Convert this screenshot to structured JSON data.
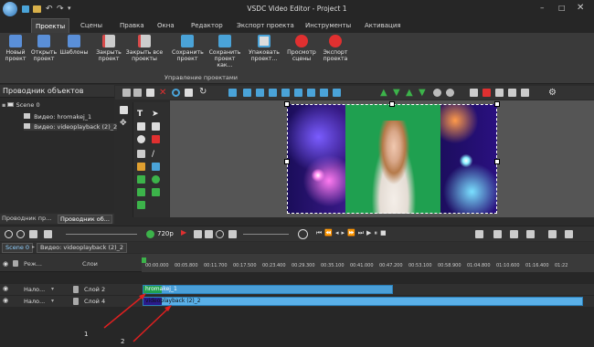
{
  "window": {
    "title": "VSDC Video Editor - Project 1"
  },
  "tabs": [
    {
      "label": "Проекты"
    },
    {
      "label": "Сцены"
    },
    {
      "label": "Правка"
    },
    {
      "label": "Окна"
    },
    {
      "label": "Редактор"
    },
    {
      "label": "Экспорт проекта"
    },
    {
      "label": "Инструменты"
    },
    {
      "label": "Активация"
    }
  ],
  "ribbon": {
    "buttons": [
      {
        "label": "Новый проект",
        "icon": "new-project-icon",
        "color": "#5a8fd8"
      },
      {
        "label": "Открыть проект",
        "icon": "open-project-icon",
        "color": "#5a8fd8"
      },
      {
        "label": "Шаблоны",
        "icon": "templates-icon",
        "color": "#5a8fd8"
      },
      {
        "label": "Закрыть проект",
        "icon": "close-project-icon",
        "color": "#d84a4a"
      },
      {
        "label": "Закрыть все проекты",
        "icon": "close-all-icon",
        "color": "#d84a4a"
      },
      {
        "label": "Сохранить проект",
        "icon": "save-project-icon",
        "color": "#4aa3d8"
      },
      {
        "label": "Сохранить проект как...",
        "icon": "save-as-icon",
        "color": "#4aa3d8"
      },
      {
        "label": "Упаковать проект...",
        "icon": "package-icon",
        "color": "#4aa3d8"
      },
      {
        "label": "Просмотр сцены",
        "icon": "preview-icon",
        "color": "#e03030"
      },
      {
        "label": "Экспорт проекта",
        "icon": "export-icon",
        "color": "#e03030"
      }
    ],
    "group_label": "Управление проектами"
  },
  "explorer": {
    "title": "Проводник объектов",
    "tree": [
      {
        "label": "Scene 0"
      },
      {
        "label": "Видео: hromakej_1"
      },
      {
        "label": "Видео: videoplayback (2)_2"
      }
    ],
    "bottom_tabs": [
      {
        "label": "Проводник пр..."
      },
      {
        "label": "Проводник об..."
      }
    ]
  },
  "playback": {
    "resolution": "720p"
  },
  "timeline": {
    "breadcrumbs": [
      {
        "label": "Scene 0"
      },
      {
        "label": "Видео: videoplayback (2)_2"
      }
    ],
    "header": {
      "blend_col": "Реж...",
      "layers_col": "Слои"
    },
    "ticks": [
      "00:00.000",
      "00:05.800",
      "00:11.700",
      "00:17.500",
      "00:23.400",
      "00:29.300",
      "00:35.100",
      "00:41.000",
      "00:47.200",
      "00:53.100",
      "00:58.900",
      "01:04.800",
      "01:10.600",
      "01:16.400",
      "01:22"
    ],
    "tracks": [
      {
        "blend": "Нало...",
        "layer": "Слой 2",
        "clip": "hromakej_1",
        "clip_color": "#4a9fd8"
      },
      {
        "blend": "Нало...",
        "layer": "Слой 4",
        "clip": "videoplayback (2)_2",
        "clip_color": "#5ab0e8"
      }
    ],
    "annotations": [
      "1",
      "2"
    ]
  },
  "colors": {
    "accent": "#4a9fd8",
    "green_screen": "#1fa050",
    "annotation": "#e02020"
  }
}
